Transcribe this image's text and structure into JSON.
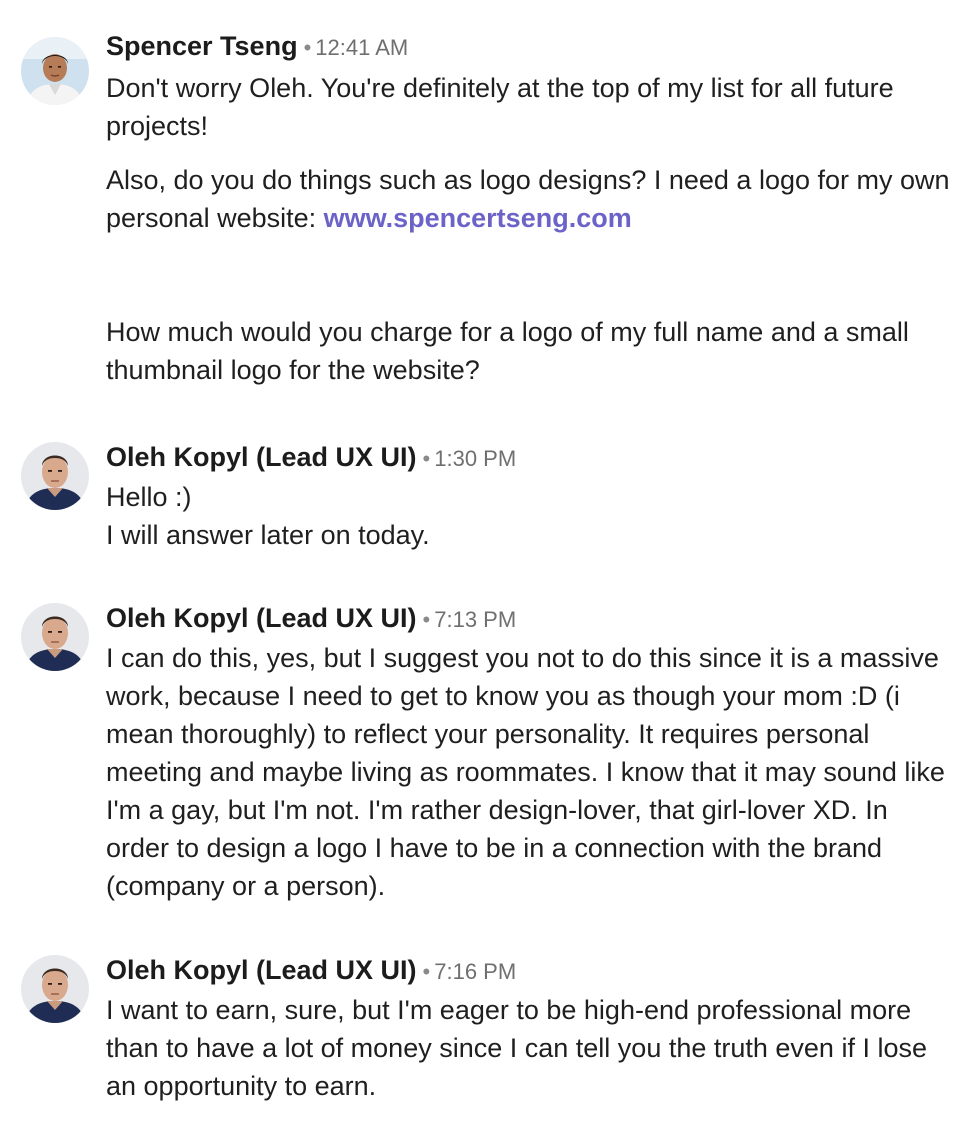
{
  "messages": [
    {
      "sender": "Spencer Tseng",
      "separator": "•",
      "time": "12:41 AM",
      "avatar": "spencer-avatar",
      "paragraphs": [
        {
          "text": "Don't worry Oleh. You're definitely at the top of my list for all future projects!"
        },
        {
          "text": "Also, do you do things such as logo designs? I need a logo for my own personal website: ",
          "link": "www.spencertseng.com"
        },
        {
          "text": "How much would you charge for a logo of my full name and a small thumbnail logo for the website?"
        }
      ]
    },
    {
      "sender": "Oleh Kopyl (Lead UX UI)",
      "separator": "•",
      "time": "1:30 PM",
      "avatar": "oleh-avatar",
      "paragraphs": [
        {
          "lines": [
            "Hello :)",
            "I will answer later on today."
          ]
        }
      ]
    },
    {
      "sender": "Oleh Kopyl (Lead UX UI)",
      "separator": "•",
      "time": "7:13 PM",
      "avatar": "oleh-avatar",
      "paragraphs": [
        {
          "text": "I can do this, yes, but I suggest you not to do this since it is a massive work, because I need to get to know you as though your mom :D (i mean thoroughly) to reflect your personality. It requires personal meeting and maybe living as roommates. I know that it may sound like I'm a gay, but I'm not. I'm rather design-lover, that girl-lover XD. In order to design a logo I have to be in a connection with the brand (company or a person)."
        }
      ]
    },
    {
      "sender": "Oleh Kopyl (Lead UX UI)",
      "separator": "•",
      "time": "7:16 PM",
      "avatar": "oleh-avatar",
      "paragraphs": [
        {
          "text": "I want to earn, sure, but I'm eager to be high-end professional more than to have a lot of money since I can tell you the truth even if I lose an opportunity to earn."
        }
      ]
    }
  ],
  "colors": {
    "link": "#6b63c7",
    "time": "#6f6f6f",
    "text": "#1f1f1f"
  }
}
